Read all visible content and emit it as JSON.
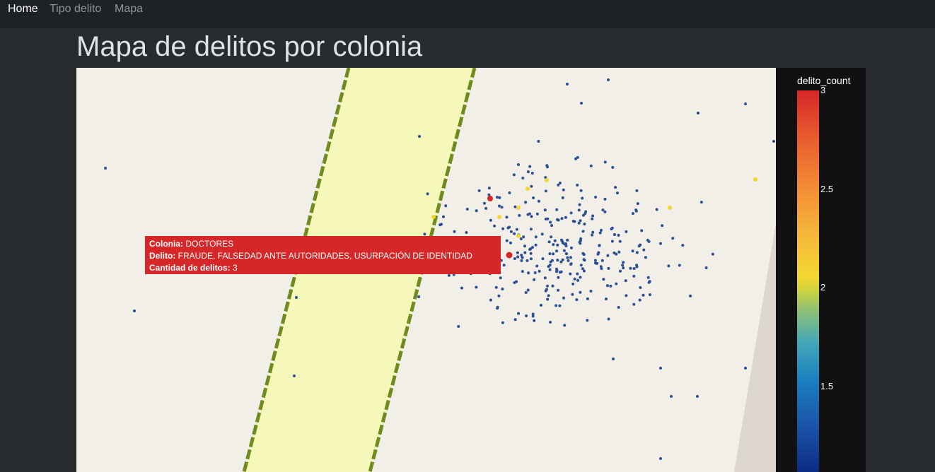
{
  "nav": {
    "items": [
      {
        "label": "Home",
        "active": true
      },
      {
        "label": "Tipo delito",
        "active": false
      },
      {
        "label": "Mapa",
        "active": false
      }
    ]
  },
  "page": {
    "title": "Mapa de delitos por colonia"
  },
  "tooltip": {
    "colonia_label": "Colonia:",
    "colonia_value": " DOCTORES",
    "delito_label": "Delito:",
    "delito_value": " FRAUDE, FALSEDAD ANTE AUTORIDADES, USURPACIÓN DE IDENTIDAD",
    "cantidad_label": "Cantidad de delitos:",
    "cantidad_value": " 3"
  },
  "colorbar": {
    "title": "delito_count",
    "ticks": [
      "3",
      "2.5",
      "2",
      "1.5"
    ]
  },
  "colors": {
    "low": "#2c4f94",
    "mid": "#f2d731",
    "high": "#d62728",
    "map_bg": "#f2efe9",
    "road_fill": "#f5f8b8",
    "road_edge": "#6f8a1f"
  }
}
